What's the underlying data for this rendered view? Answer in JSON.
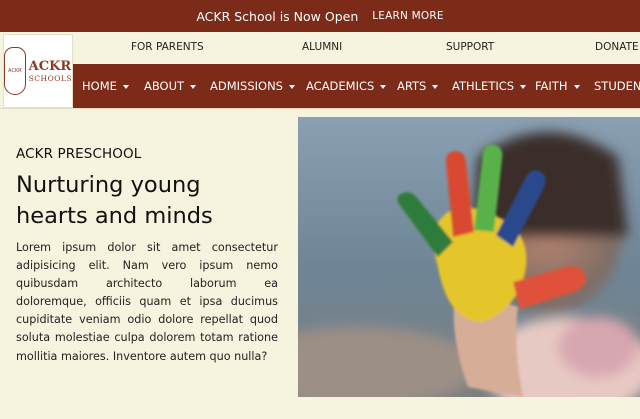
{
  "announcement": {
    "message": "ACKR School is Now Open",
    "cta": "LEARN MORE"
  },
  "logo": {
    "name": "ACKR",
    "tagline": "SCHOOLS",
    "crest_text": "ACKR"
  },
  "secondary_nav": [
    "FOR PARENTS",
    "ALUMNI",
    "SUPPORT",
    "DONATE"
  ],
  "main_nav": [
    "HOME",
    "ABOUT",
    "ADMISSIONS",
    "ACADEMICS",
    "ARTS",
    "ATHLETICS",
    "FAITH",
    "STUDENT"
  ],
  "hero": {
    "eyebrow": "ACKR PRESCHOOL",
    "headline_line1": "Nurturing young",
    "headline_line2": "hearts and minds",
    "body": "Lorem ipsum dolor sit amet consectetur adipisicing elit. Nam vero ipsum nemo quibusdam architecto laborum ea doloremque, officiis quam et ipsa ducimus cupiditate veniam odio dolore repellat quod soluta molestiae culpa dolorem totam ratione mollitia maiores. Inventore autem quo nulla?"
  },
  "colors": {
    "brand": "#7b2b17",
    "background": "#f6f3de"
  }
}
